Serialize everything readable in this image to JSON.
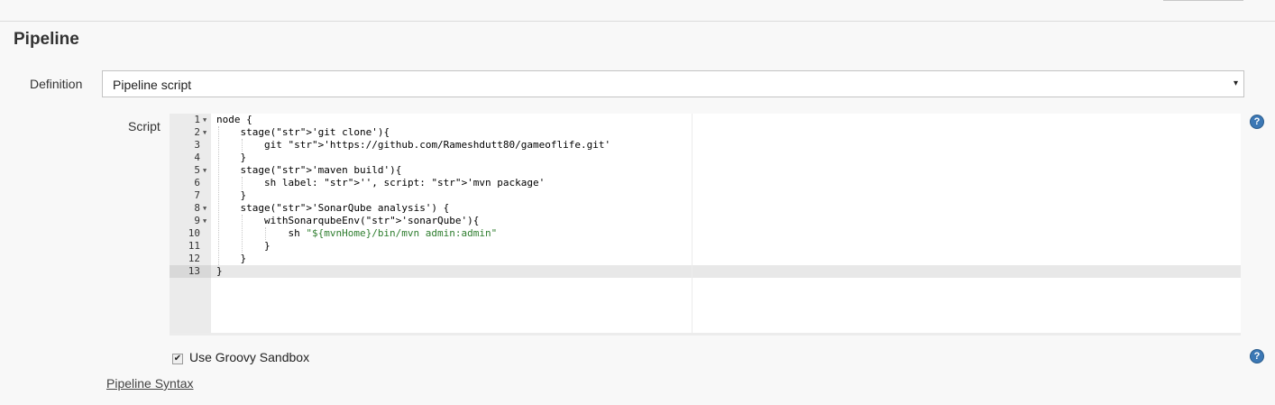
{
  "section": {
    "title": "Pipeline"
  },
  "definition": {
    "label": "Definition",
    "selected": "Pipeline script",
    "arrow_icon": "▾"
  },
  "script": {
    "label": "Script",
    "lines": [
      {
        "num": "1",
        "text": "node {"
      },
      {
        "num": "2",
        "text": "    stage('git clone'){"
      },
      {
        "num": "3",
        "text": "        git 'https://github.com/Rameshdutt80/gameoflife.git'"
      },
      {
        "num": "4",
        "text": "    }"
      },
      {
        "num": "5",
        "text": "    stage('maven build'){"
      },
      {
        "num": "6",
        "text": "        sh label: '', script: 'mvn package'"
      },
      {
        "num": "7",
        "text": "    }"
      },
      {
        "num": "8",
        "text": "    stage('SonarQube analysis') {"
      },
      {
        "num": "9",
        "text": "        withSonarqubeEnv('sonarQube'){"
      },
      {
        "num": "10",
        "text": "            sh \"${mvnHome}/bin/mvn admin:admin\""
      },
      {
        "num": "11",
        "text": "        }"
      },
      {
        "num": "12",
        "text": "    }"
      },
      {
        "num": "13",
        "text": "}"
      }
    ],
    "fold_icon": "▼"
  },
  "help_icon": "?",
  "sandbox": {
    "label": "Use Groovy Sandbox",
    "checked": true,
    "check_glyph": "✔"
  },
  "syntax_link": "Pipeline Syntax"
}
